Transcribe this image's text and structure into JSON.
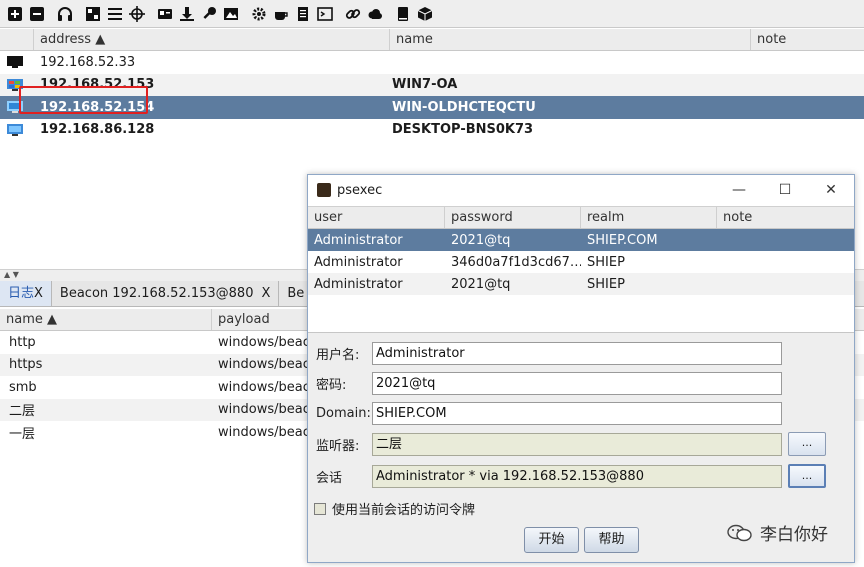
{
  "toolbar": {
    "icons": [
      "plus-icon",
      "minus-icon",
      "headphones-icon",
      "pivot-graph-icon",
      "list-icon",
      "crosshair-icon",
      "credentials-icon",
      "download-icon",
      "key-icon",
      "image-icon",
      "gear-icon",
      "coffee-icon",
      "document-icon",
      "terminal-icon",
      "link-icon",
      "cloud-icon",
      "book-icon",
      "cube-icon"
    ]
  },
  "targets": {
    "columns": [
      "address ▲",
      "name",
      "note"
    ],
    "rows": [
      {
        "address": "192.168.52.33",
        "name": "",
        "note": "",
        "bold": false,
        "selected": false
      },
      {
        "address": "192.168.52.153",
        "name": "WIN7-OA",
        "note": "",
        "bold": true,
        "selected": false
      },
      {
        "address": "192.168.52.154",
        "name": "WIN-OLDHCTEQCTU",
        "note": "",
        "bold": true,
        "selected": true
      },
      {
        "address": "192.168.86.128",
        "name": "DESKTOP-BNS0K73",
        "note": "",
        "bold": true,
        "selected": false
      }
    ]
  },
  "tabs": [
    {
      "label": "日志",
      "close": "X"
    },
    {
      "label": "Beacon 192.168.52.153@880",
      "close": "X"
    },
    {
      "label": "Be",
      "close": ""
    }
  ],
  "listeners": {
    "columns": [
      "name ▲",
      "payload"
    ],
    "rows": [
      {
        "name": "http",
        "payload": "windows/beaco"
      },
      {
        "name": "https",
        "payload": "windows/beaco"
      },
      {
        "name": "smb",
        "payload": "windows/beaco"
      },
      {
        "name": "二层",
        "payload": "windows/beaco"
      },
      {
        "name": "一层",
        "payload": "windows/beaco"
      }
    ]
  },
  "dialog": {
    "title": "psexec",
    "window_buttons": {
      "minimize": "—",
      "maximize": "☐",
      "close": "✕"
    },
    "creds": {
      "columns": [
        "user",
        "password",
        "realm",
        "note"
      ],
      "rows": [
        {
          "user": "Administrator",
          "password": "2021@tq",
          "realm": "SHIEP.COM",
          "note": ""
        },
        {
          "user": "Administrator",
          "password": "346d0a7f1d3cd67…",
          "realm": "SHIEP",
          "note": ""
        },
        {
          "user": "Administrator",
          "password": "2021@tq",
          "realm": "SHIEP",
          "note": ""
        }
      ]
    },
    "form": {
      "user_label": "用户名:",
      "user_value": "Administrator",
      "pass_label": "密码:",
      "pass_value": "2021@tq",
      "domain_label": "Domain:",
      "domain_value": "SHIEP.COM",
      "listener_label": "监听器:",
      "listener_value": "二层",
      "session_label": "会话",
      "session_value": "Administrator * via  192.168.52.153@880",
      "pick_label": "...",
      "checkbox_label": "使用当前会话的访问令牌",
      "start_label": "开始",
      "help_label": "帮助"
    }
  },
  "watermark": "李白你好"
}
